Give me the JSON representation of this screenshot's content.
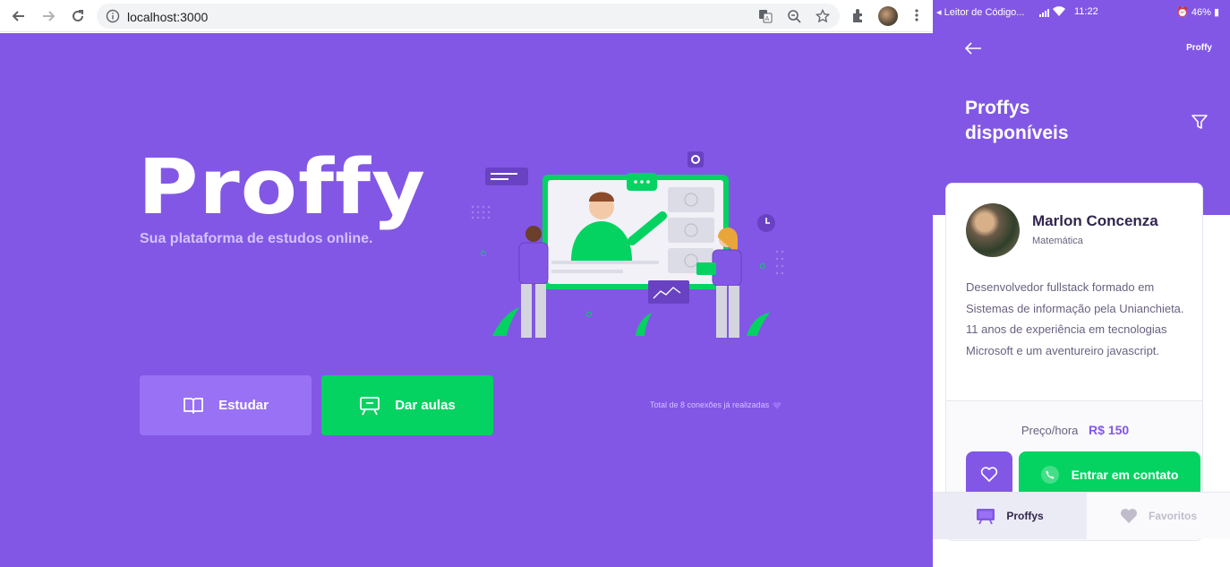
{
  "browser": {
    "url": "localhost:3000",
    "icons": [
      "back-icon",
      "forward-icon",
      "reload-icon",
      "info-icon",
      "translate-icon",
      "zoom-icon",
      "star-icon",
      "extensions-icon",
      "menu-icon"
    ]
  },
  "landing": {
    "logo": "Proffy",
    "tagline": "Sua plataforma de estudos online.",
    "study_label": "Estudar",
    "teach_label": "Dar aulas",
    "connections": "Total de 8 conexões já realizadas",
    "colors": {
      "background": "#8257e5",
      "study": "#9871f5",
      "teach": "#04d361"
    }
  },
  "phone": {
    "status": {
      "left": "Leitor de Código...",
      "time": "11:22",
      "battery": "46%"
    },
    "header_logo": "Proffy",
    "title_line1": "Proffys",
    "title_line2": "disponíveis",
    "teacher": {
      "name": "Marlon Concenza",
      "subject": "Matemática",
      "bio": "Desenvolvedor fullstack formado em Sistemas de informação pela Unianchieta. 11 anos de experiência em tecnologias Microsoft e um aventureiro javascript.",
      "price_label": "Preço/hora",
      "price_value": "R$ 150",
      "contact_label": "Entrar em contato"
    },
    "tabs": {
      "proffys": "Proffys",
      "favorites": "Favoritos"
    }
  }
}
